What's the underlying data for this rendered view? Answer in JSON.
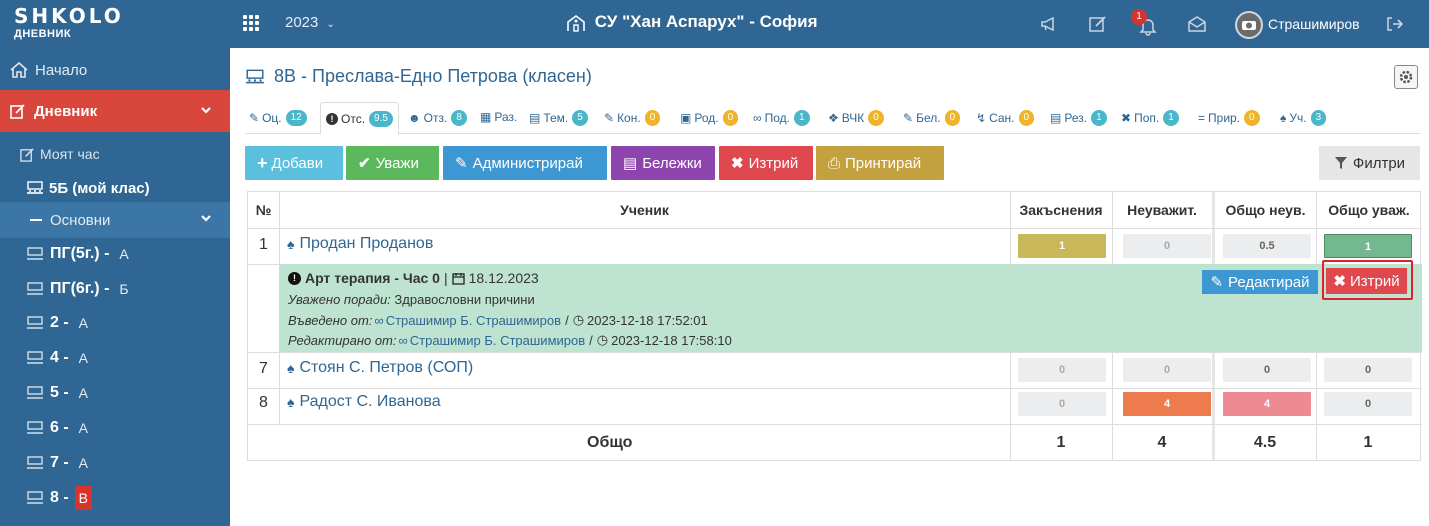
{
  "topbar": {
    "logo_main": "SHKOLO",
    "logo_sub": "ДНЕВНИК",
    "year": "2023",
    "school": "СУ \"Хан Аспарух\" - София",
    "notifications_count": "1",
    "username": "Страшимиров"
  },
  "sidebar": {
    "home": "Начало",
    "diary": "Дневник",
    "my_hour": "Моят час",
    "my_class": "5Б (мой клас)",
    "basic": "Основни",
    "classes": [
      {
        "name": "ПГ(5г.) -",
        "section": "А"
      },
      {
        "name": "ПГ(6г.) -",
        "section": "Б"
      },
      {
        "name": "2 -",
        "section": "А"
      },
      {
        "name": "4 -",
        "section": "А"
      },
      {
        "name": "5 -",
        "section": "А"
      },
      {
        "name": "6 -",
        "section": "А"
      },
      {
        "name": "7 -",
        "section": "А"
      },
      {
        "name": "8 -",
        "section": "В"
      }
    ]
  },
  "page": {
    "title": "8В - Преслава-Едно Петрова (класен)"
  },
  "tabs": [
    {
      "label": "Оц.",
      "count": "12",
      "color": "teal"
    },
    {
      "label": "Отс.",
      "count": "9.5",
      "color": "teal"
    },
    {
      "label": "Отз.",
      "count": "8",
      "color": "teal"
    },
    {
      "label": "Раз.",
      "count": "",
      "color": ""
    },
    {
      "label": "Тем.",
      "count": "5",
      "color": "teal"
    },
    {
      "label": "Кон.",
      "count": "0",
      "color": "yellow"
    },
    {
      "label": "Род.",
      "count": "0",
      "color": "yellow"
    },
    {
      "label": "Под.",
      "count": "1",
      "color": "teal"
    },
    {
      "label": "ВЧК",
      "count": "0",
      "color": "yellow"
    },
    {
      "label": "Бел.",
      "count": "0",
      "color": "yellow"
    },
    {
      "label": "Сан.",
      "count": "0",
      "color": "yellow"
    },
    {
      "label": "Рез.",
      "count": "1",
      "color": "teal"
    },
    {
      "label": "Поп.",
      "count": "1",
      "color": "teal"
    },
    {
      "label": "Прир.",
      "count": "0",
      "color": "yellow"
    },
    {
      "label": "Уч.",
      "count": "3",
      "color": "teal"
    }
  ],
  "toolbar": {
    "add": "Добави",
    "excuse": "Уважи",
    "administer": "Администрирай",
    "notes": "Бележки",
    "delete": "Изтрий",
    "print": "Принтирай",
    "filters": "Филтри"
  },
  "table": {
    "headers": {
      "num": "№",
      "student": "Ученик",
      "late": "Закъснения",
      "unexcused": "Неуважит.",
      "total_unexcused": "Общо неув.",
      "total_excused": "Общо уваж."
    },
    "rows": [
      {
        "num": "1",
        "name": "Продан Проданов",
        "late": "1",
        "unexcused": "0",
        "total_unexcused": "0.5",
        "total_excused": "1"
      },
      {
        "num": "7",
        "name": "Стоян С. Петров (СОП)",
        "late": "0",
        "unexcused": "0",
        "total_unexcused": "0",
        "total_excused": "0"
      },
      {
        "num": "8",
        "name": "Радост С. Иванова",
        "late": "0",
        "unexcused": "4",
        "total_unexcused": "4",
        "total_excused": "0"
      }
    ],
    "detail": {
      "subject": "Арт терапия - Час 0",
      "date": "18.12.2023",
      "reason_label": "Уважено поради:",
      "reason": "Здравословни причини",
      "entered_label": "Въведено от:",
      "entered_by": "Страшимир Б. Страшимиров",
      "entered_at": "2023-12-18 17:52:01",
      "edited_label": "Редактирано от:",
      "edited_by": "Страшимир Б. Страшимиров",
      "edited_at": "2023-12-18 17:58:10",
      "edit_btn": "Редактирай",
      "delete_btn": "Изтрий"
    },
    "totals": {
      "label": "Общо",
      "late": "1",
      "unexcused": "4",
      "total_unexcused": "4.5",
      "total_excused": "1"
    }
  }
}
